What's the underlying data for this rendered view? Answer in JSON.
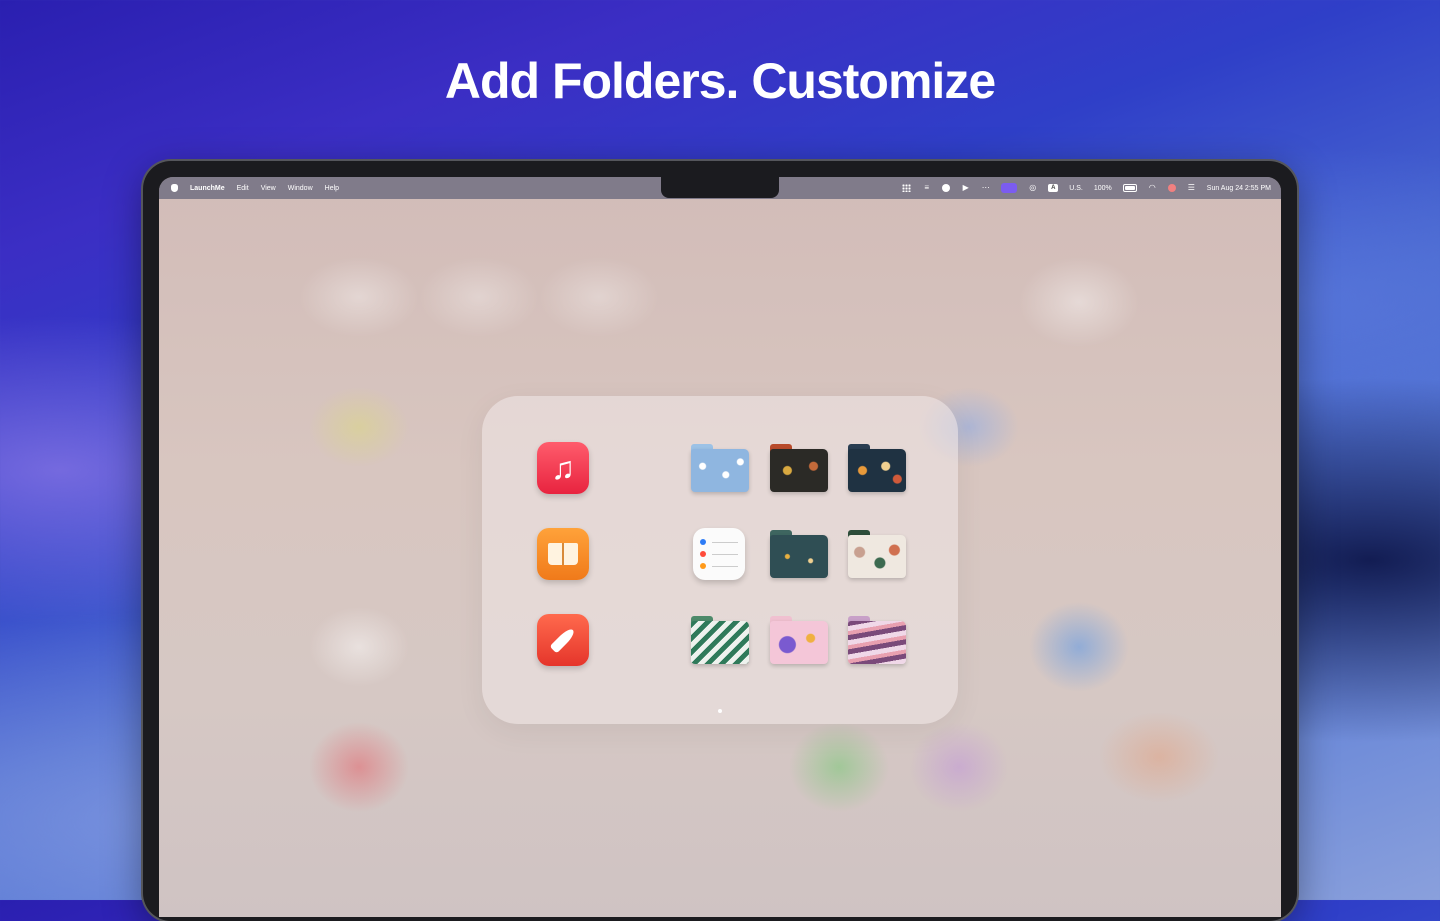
{
  "headline": "Add Folders. Customize",
  "menubar": {
    "app_name": "LaunchMe",
    "menus": [
      "Edit",
      "View",
      "Window",
      "Help"
    ],
    "input_source": "U.S.",
    "battery": "100%",
    "datetime": "Sun Aug 24  2:55 PM",
    "icons": [
      "grid-icon",
      "list-icon",
      "telegram-icon",
      "play-circle-icon",
      "dots-icon",
      "screens-icon",
      "fingerprint-icon",
      "input-badge-icon",
      "battery-icon",
      "wifi-icon",
      "color-circle-icon",
      "control-center-icon"
    ]
  },
  "folder": {
    "apps": [
      {
        "name": "Music",
        "icon": "music-icon"
      },
      {
        "name": "Books",
        "icon": "books-icon"
      },
      {
        "name": "Rocket",
        "icon": "rocket-icon"
      },
      {
        "name": "Reminders",
        "icon": "reminders-icon"
      }
    ],
    "folders": [
      {
        "pattern": "cherry-blossom"
      },
      {
        "pattern": "dark-floral-red"
      },
      {
        "pattern": "navy-floral"
      },
      {
        "pattern": "night-stars-teal"
      },
      {
        "pattern": "terrazzo-cream"
      },
      {
        "pattern": "green-forest"
      },
      {
        "pattern": "pink-abstract"
      },
      {
        "pattern": "purple-waves"
      }
    ],
    "page_count": 1
  },
  "colors": {
    "accent": "#7b5cf0",
    "background_top": "#2a1fb0",
    "background_bottom": "#8aa0dc"
  }
}
